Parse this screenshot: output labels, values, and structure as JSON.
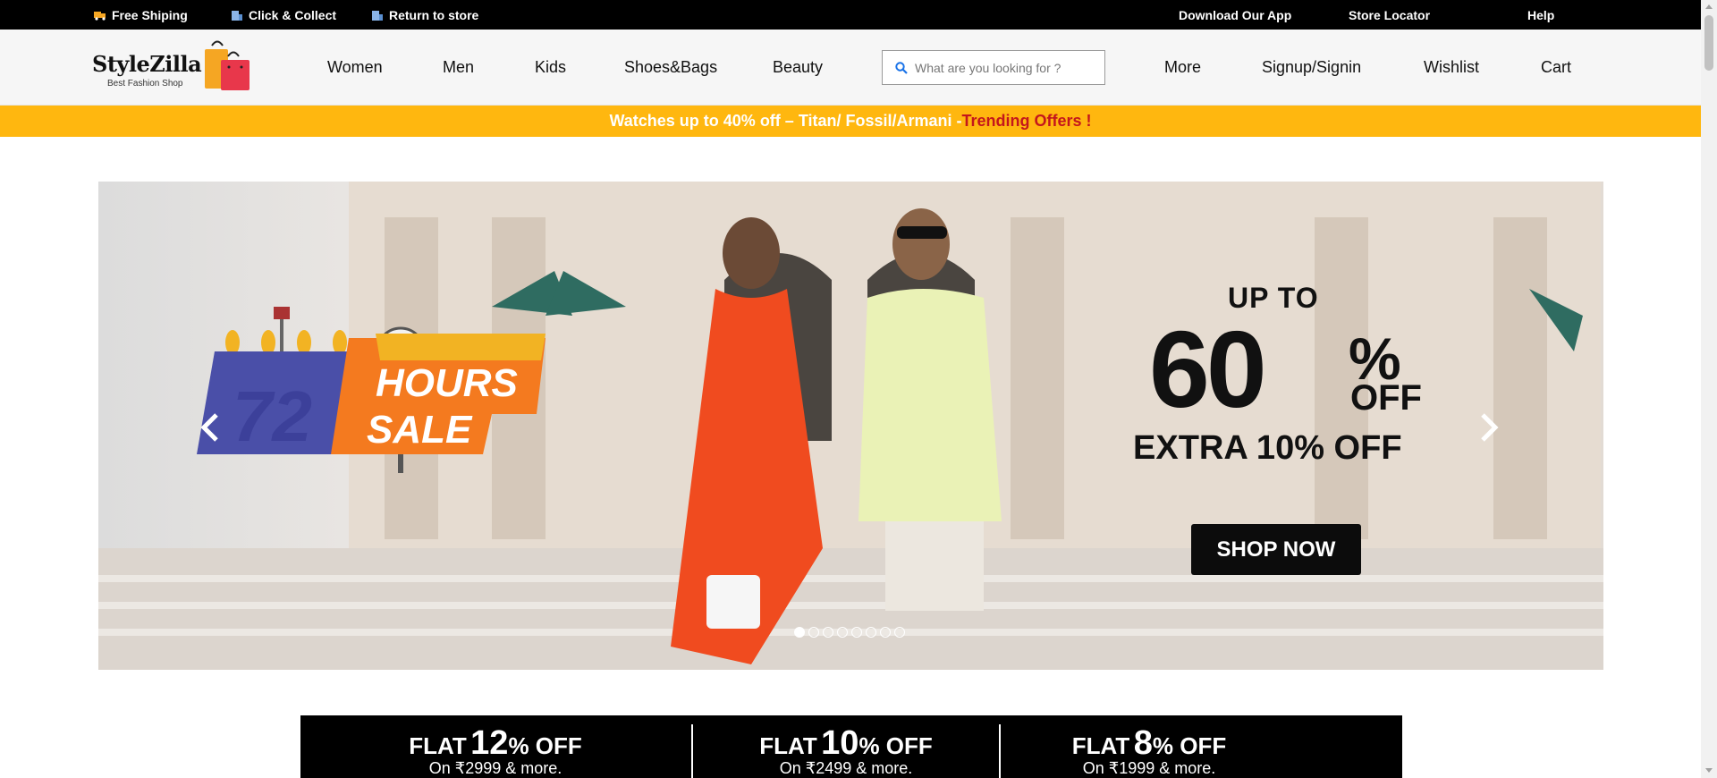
{
  "topbar": {
    "free_shipping": "Free Shiping",
    "click_collect": "Click & Collect",
    "return_store": "Return to store",
    "download_app": "Download Our App",
    "store_locator": "Store Locator",
    "help": "Help"
  },
  "header": {
    "logo_title": "StyleZilla",
    "logo_subtitle": "Best Fashion Shop",
    "nav": {
      "women": "Women",
      "men": "Men",
      "kids": "Kids",
      "shoes_bags": "Shoes&Bags",
      "beauty": "Beauty",
      "more": "More",
      "signin": "Signup/Signin",
      "wishlist": "Wishlist",
      "cart": "Cart"
    },
    "search_placeholder": "What are you looking for ?"
  },
  "offer_strip": {
    "main": "Watches up to 40% off – Titan/ Fossil/Armani -",
    "highlight": "Trending Offers !"
  },
  "hero": {
    "badge_number": "72",
    "badge_line1": "HOURS",
    "badge_line2": "SALE",
    "up_to": "UP TO",
    "percent_number": "60",
    "percent_sign": "%",
    "off": "OFF",
    "extra": "EXTRA 10% OFF",
    "cta": "SHOP NOW",
    "slide_count": 8,
    "active_slide": 1
  },
  "flat_offers": [
    {
      "prefix": "FLAT",
      "value": "12",
      "suffix": "% OFF",
      "condition": "On ₹2999 & more."
    },
    {
      "prefix": "FLAT",
      "value": "10",
      "suffix": "% OFF",
      "condition": "On ₹2499 & more."
    },
    {
      "prefix": "FLAT",
      "value": "8",
      "suffix": "% OFF",
      "condition": "On ₹1999 & more."
    }
  ],
  "colors": {
    "topbar_bg": "#000000",
    "offer_bg": "#ffb70f",
    "offer_highlight": "#c4161c",
    "badge_blue": "#4a4fa8",
    "badge_orange": "#f47a1f"
  }
}
